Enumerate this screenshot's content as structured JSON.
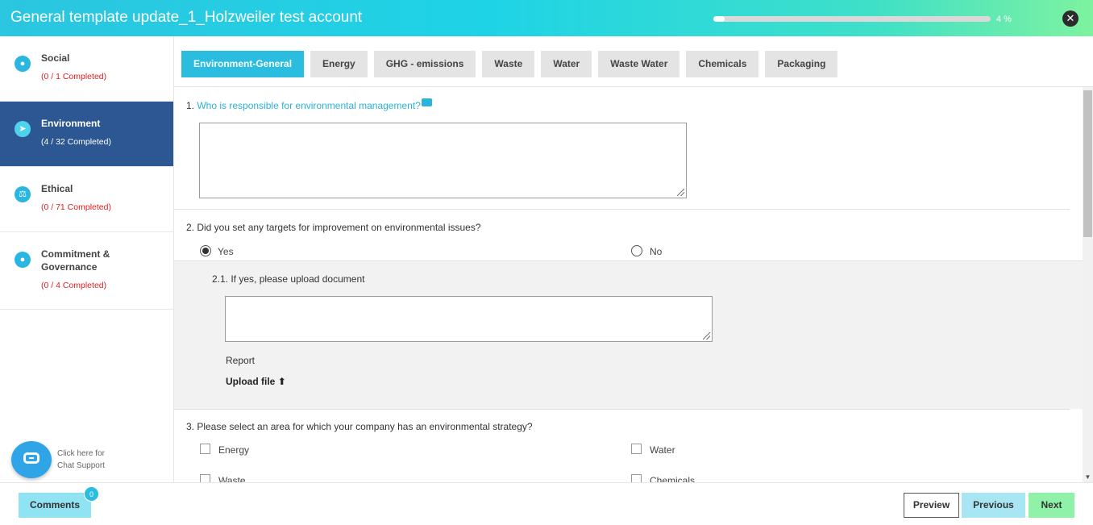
{
  "header": {
    "title": "General template update_1_Holzweiler test account",
    "progress_percent": 4,
    "progress_text": "4 %",
    "close_icon": "close-icon"
  },
  "sidebar": {
    "items": [
      {
        "label": "Social",
        "count": "(0 / 1 Completed)",
        "icon": "person-icon",
        "active": false
      },
      {
        "label": "Environment",
        "count": "(4 / 32 Completed)",
        "icon": "leaf-icon",
        "active": true
      },
      {
        "label": "Ethical",
        "count": "(0 / 71 Completed)",
        "icon": "scale-icon",
        "active": false
      },
      {
        "label": "Commitment & Governance",
        "count": "(0 / 4 Completed)",
        "icon": "person-icon",
        "active": false
      }
    ],
    "chat_text": "Click here for Chat Support"
  },
  "tabs": [
    {
      "label": "Environment-General",
      "active": true
    },
    {
      "label": "Energy",
      "active": false
    },
    {
      "label": "GHG - emissions",
      "active": false
    },
    {
      "label": "Waste",
      "active": false
    },
    {
      "label": "Water",
      "active": false
    },
    {
      "label": "Waste Water",
      "active": false
    },
    {
      "label": "Chemicals",
      "active": false
    },
    {
      "label": "Packaging",
      "active": false
    }
  ],
  "questions": {
    "q1": {
      "number": "1.",
      "text": "Who is responsible for environmental management?",
      "answer": ""
    },
    "q2": {
      "text": "2. Did you set any targets for improvement on environmental issues?",
      "options": [
        "Yes",
        "No"
      ],
      "selected": "Yes"
    },
    "q2_1": {
      "text": "2.1. If yes, please upload document",
      "answer": "",
      "file_label": "Report",
      "upload_label": "Upload file"
    },
    "q3": {
      "text": "3. Please select an area for which your company has an environmental strategy?",
      "options": [
        "Energy",
        "Water",
        "Waste",
        "Chemicals"
      ]
    }
  },
  "footer": {
    "comments_label": "Comments",
    "comments_count": "0",
    "preview_label": "Preview",
    "previous_label": "Previous",
    "next_label": "Next"
  },
  "colors": {
    "accent": "#2bbde0",
    "sidebar_active": "#2d5792",
    "next_button": "#8ff2a8"
  }
}
